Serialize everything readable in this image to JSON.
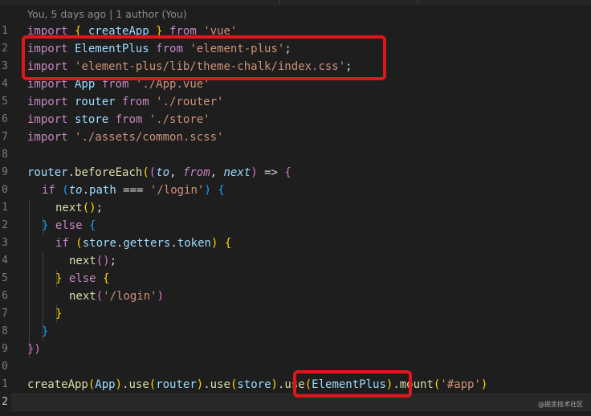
{
  "codelens": "You, 5 days ago | 1 author (You)",
  "gutter": [
    "1",
    "2",
    "3",
    "4",
    "5",
    "6",
    "7",
    "8",
    "9",
    "0",
    "1",
    "2",
    "3",
    "4",
    "5",
    "6",
    "7",
    "8",
    "9",
    "0",
    "1",
    "2"
  ],
  "code": {
    "l1": [
      "import",
      " ",
      "{",
      " createApp ",
      "}",
      " ",
      "from",
      " ",
      "'vue'"
    ],
    "l2": [
      "import",
      " ElementPlus ",
      "from",
      " ",
      "'element-plus'",
      ";"
    ],
    "l3": [
      "import",
      " ",
      "'element-plus/lib/theme-chalk/index.css'",
      ";"
    ],
    "l4": [
      "import",
      " App ",
      "from",
      " ",
      "'./App.vue'"
    ],
    "l5": [
      "import",
      " router ",
      "from",
      " ",
      "'./router'"
    ],
    "l6": [
      "import",
      " store ",
      "from",
      " ",
      "'./store'"
    ],
    "l7": [
      "import",
      " ",
      "'./assets/common.scss'"
    ],
    "l9": [
      "router",
      ".",
      "beforeEach",
      "(",
      "(",
      "to",
      ", ",
      "from",
      ", ",
      "next",
      ")",
      " => ",
      "{"
    ],
    "l10": [
      "if",
      " ",
      "(",
      "to",
      ".",
      "path",
      " === ",
      "'/login'",
      ")",
      " ",
      "{"
    ],
    "l11": [
      "next",
      "()",
      ";"
    ],
    "l12": [
      "}",
      " ",
      "else",
      " ",
      "{"
    ],
    "l13": [
      "if",
      " ",
      "(",
      "store",
      ".",
      "getters",
      ".",
      "token",
      ")",
      " ",
      "{"
    ],
    "l14": [
      "next",
      "()",
      ";"
    ],
    "l15": [
      "}",
      " ",
      "else",
      " ",
      "{"
    ],
    "l16": [
      "next",
      "(",
      "'/login'",
      ")"
    ],
    "l17": [
      "}"
    ],
    "l18": [
      "}"
    ],
    "l19": [
      "})"
    ],
    "l21": [
      "createApp",
      "(",
      "App",
      ")",
      ".",
      "use",
      "(",
      "router",
      ")",
      ".",
      "use",
      "(",
      "store",
      ")",
      ".",
      "use",
      "(",
      "ElementPlus",
      ")",
      ".",
      "mount",
      "(",
      "'#app'",
      ")"
    ]
  },
  "watermark": "@掘金技术社区",
  "colors": {
    "highlight_box": "#e0161b",
    "background": "#1e1e1e",
    "keyword": "#c586c0",
    "string": "#ce9178",
    "function": "#dcdcaa",
    "variable": "#9cdcfe"
  }
}
